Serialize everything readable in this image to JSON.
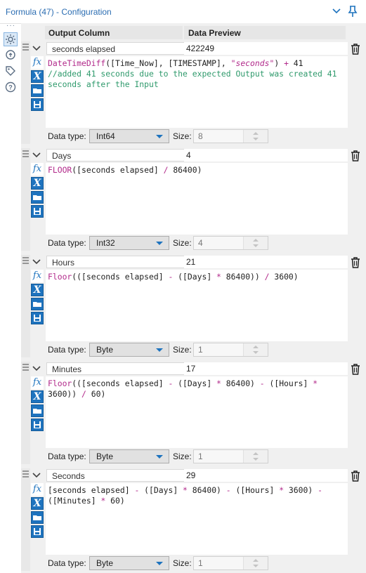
{
  "window": {
    "title": "Formula (47) - Configuration"
  },
  "nav": {
    "icons": [
      "gear-icon",
      "gear-arrow-icon",
      "tag-icon",
      "help-icon"
    ]
  },
  "header": {
    "output_column": "Output Column",
    "data_preview": "Data Preview"
  },
  "labels": {
    "data_type": "Data type:",
    "size": "Size:"
  },
  "formulas": [
    {
      "name": "seconds elapsed",
      "preview": "422249",
      "data_type": "Int64",
      "size": "8",
      "code": "DateTimeDiff([Time_Now], [TIMESTAMP], \"seconds\") + 41\n//added 41 seconds due to the expected Output was created 41 seconds after the Input"
    },
    {
      "name": "Days",
      "preview": "4",
      "data_type": "Int32",
      "size": "4",
      "code": "FLOOR([seconds elapsed] / 86400)"
    },
    {
      "name": "Hours",
      "preview": "21",
      "data_type": "Byte",
      "size": "1",
      "code": "Floor(([seconds elapsed] - ([Days] * 86400)) / 3600)"
    },
    {
      "name": "Minutes",
      "preview": "17",
      "data_type": "Byte",
      "size": "1",
      "code": "Floor(([seconds elapsed] - ([Days] * 86400) - ([Hours] * 3600)) / 60)"
    },
    {
      "name": "Seconds",
      "preview": "29",
      "data_type": "Byte",
      "size": "1",
      "code": "[seconds elapsed] - ([Days] * 86400) - ([Hours] * 3600) - ([Minutes] * 60)"
    }
  ],
  "colors": {
    "accent": "#1e73be",
    "function": "#b22a8b",
    "comment": "#2f9a6c",
    "title": "#2b6db2"
  }
}
